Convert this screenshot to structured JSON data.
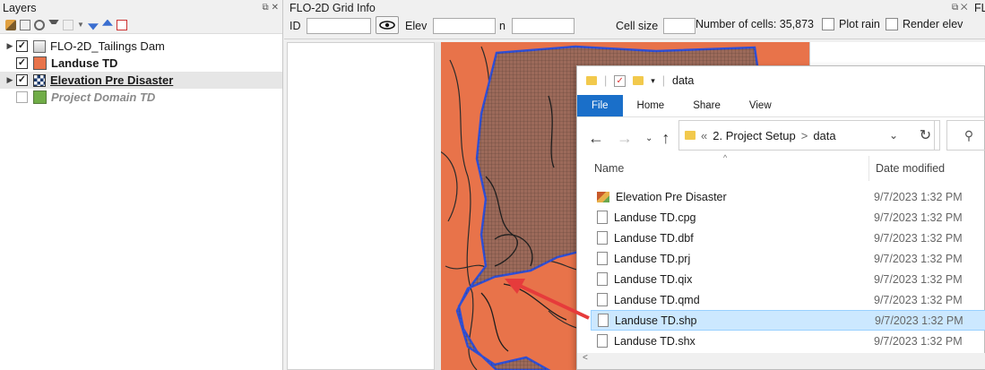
{
  "layers_panel": {
    "title": "Layers",
    "items": [
      {
        "label": "FLO-2D_Tailings Dam",
        "checked": true,
        "expandable": true,
        "icon": "group-icon",
        "style": "normal"
      },
      {
        "label": "Landuse TD",
        "checked": true,
        "expandable": false,
        "icon": "polygon-swatch-icon",
        "color": "#e8734a",
        "style": "bold"
      },
      {
        "label": "Elevation Pre Disaster",
        "checked": true,
        "expandable": true,
        "icon": "raster-icon",
        "style": "bold-underline"
      },
      {
        "label": "Project Domain TD",
        "checked": false,
        "expandable": false,
        "icon": "polygon-swatch-icon",
        "color": "#70ad47",
        "style": "gray-italic"
      }
    ]
  },
  "grid_info": {
    "title": "FLO-2D Grid Info",
    "id_label": "ID",
    "elev_label": "Elev",
    "n_label": "n",
    "cell_size_label": "Cell size",
    "num_cells_label": "Number of cells: 35,873",
    "plot_rain_label": "Plot rain",
    "render_elev_label": "Render elev",
    "side_title": "FLC"
  },
  "explorer": {
    "folder_name": "data",
    "tabs": [
      "File",
      "Home",
      "Share",
      "View"
    ],
    "breadcrumb": {
      "prefix": "«",
      "parent": "2. Project Setup",
      "sep": ">",
      "current": "data"
    },
    "columns": {
      "name": "Name",
      "date": "Date modified"
    },
    "files": [
      {
        "name": "Elevation Pre Disaster",
        "date": "9/7/2023 1:32 PM",
        "icon": "raster-file-icon",
        "selected": false
      },
      {
        "name": "Landuse TD.cpg",
        "date": "9/7/2023 1:32 PM",
        "icon": "file-icon",
        "selected": false
      },
      {
        "name": "Landuse TD.dbf",
        "date": "9/7/2023 1:32 PM",
        "icon": "file-icon",
        "selected": false
      },
      {
        "name": "Landuse TD.prj",
        "date": "9/7/2023 1:32 PM",
        "icon": "file-icon",
        "selected": false
      },
      {
        "name": "Landuse TD.qix",
        "date": "9/7/2023 1:32 PM",
        "icon": "file-icon",
        "selected": false
      },
      {
        "name": "Landuse TD.qmd",
        "date": "9/7/2023 1:32 PM",
        "icon": "file-icon",
        "selected": false
      },
      {
        "name": "Landuse TD.shp",
        "date": "9/7/2023 1:32 PM",
        "icon": "file-icon",
        "selected": true
      },
      {
        "name": "Landuse TD.shx",
        "date": "9/7/2023 1:32 PM",
        "icon": "file-icon",
        "selected": false
      }
    ]
  },
  "colors": {
    "landuse": "#e8734a",
    "domain_outline": "#2f4fd6",
    "arrow": "#e63b3b",
    "selection": "#cce8ff"
  }
}
